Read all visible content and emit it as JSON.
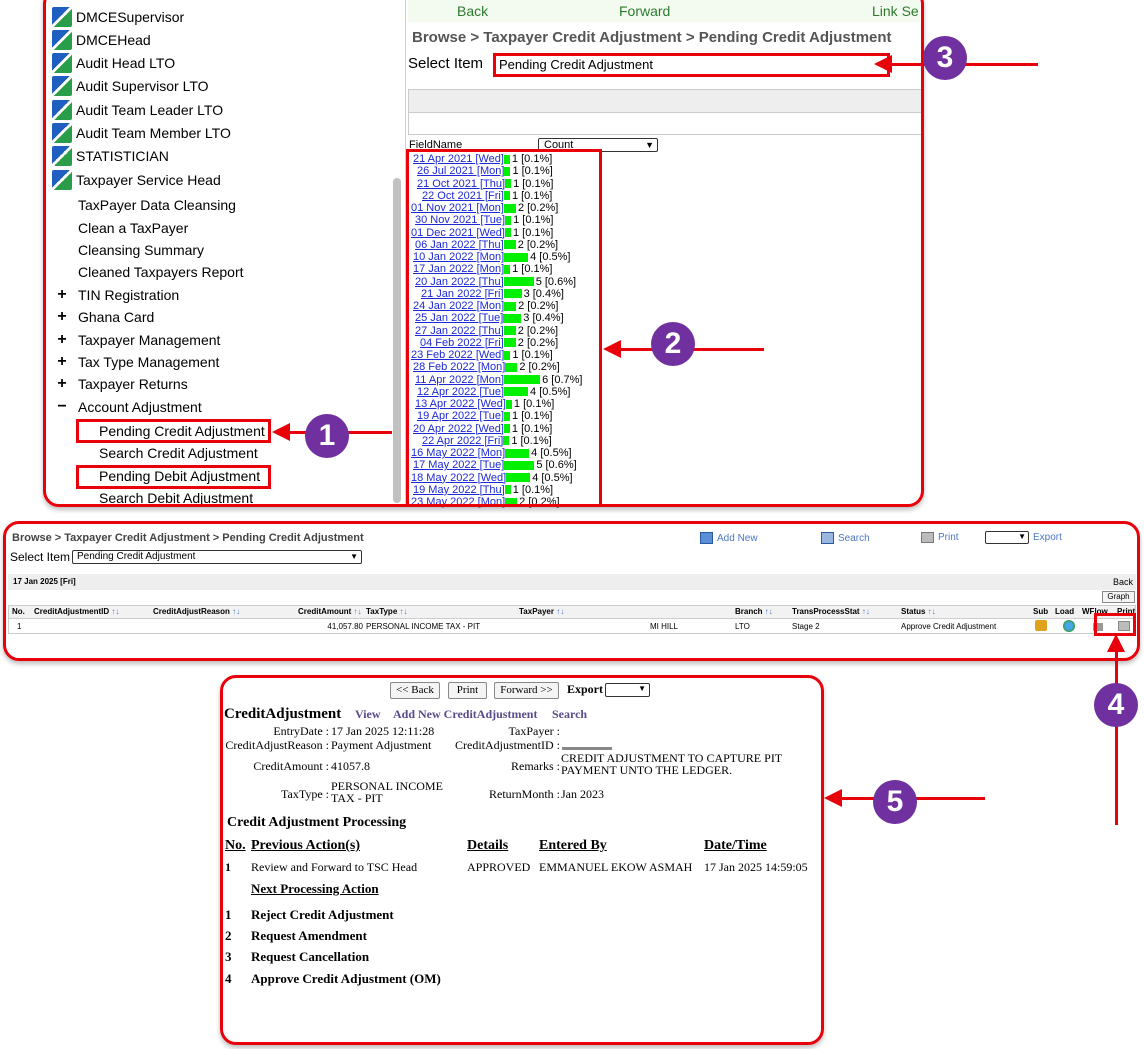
{
  "panel1": {
    "roles": [
      "DMCESupervisor",
      "DMCEHead",
      "Audit Head LTO",
      "Audit Supervisor LTO",
      "Audit Team Leader LTO",
      "Audit Team Member LTO",
      "STATISTICIAN",
      "Taxpayer Service Head"
    ],
    "submenu": [
      "TaxPayer Data Cleansing",
      "Clean a TaxPayer",
      "Cleansing Summary",
      "Cleaned Taxpayers Report"
    ],
    "expandable": [
      {
        "sign": "+",
        "label": "TIN Registration"
      },
      {
        "sign": "+",
        "label": "Ghana Card"
      },
      {
        "sign": "+",
        "label": "Taxpayer Management"
      },
      {
        "sign": "+",
        "label": "Tax Type Management"
      },
      {
        "sign": "+",
        "label": "Taxpayer Returns"
      },
      {
        "sign": "−",
        "label": "Account Adjustment"
      }
    ],
    "account_items": [
      "Pending Credit Adjustment",
      "Search Credit Adjustment",
      "Pending Debit Adjustment",
      "Search Debit Adjustment"
    ],
    "nav": {
      "back": "Back",
      "forward": "Forward",
      "link": "Link Se"
    },
    "breadcrumb": "Browse > Taxpayer Credit Adjustment > Pending Credit Adjustment",
    "select_label": "Select Item",
    "select_value": "Pending Credit Adjustment",
    "fieldname_label": "FieldName",
    "fieldname_value": "Count",
    "dates": [
      {
        "date": "21 Apr 2021 [Wed]",
        "count": 1,
        "text": "1 [0.1%]"
      },
      {
        "date": "26 Jul 2021 [Mon]",
        "count": 1,
        "text": "1 [0.1%]"
      },
      {
        "date": "21 Oct 2021 [Thu]",
        "count": 1,
        "text": "1 [0.1%]"
      },
      {
        "date": "22 Oct 2021 [Fri]",
        "count": 1,
        "text": "1 [0.1%]"
      },
      {
        "date": "01 Nov 2021 [Mon]",
        "count": 2,
        "text": "2 [0.2%]"
      },
      {
        "date": "30 Nov 2021 [Tue]",
        "count": 1,
        "text": "1 [0.1%]"
      },
      {
        "date": "01 Dec 2021 [Wed]",
        "count": 1,
        "text": "1 [0.1%]"
      },
      {
        "date": "06 Jan 2022 [Thu]",
        "count": 2,
        "text": "2 [0.2%]"
      },
      {
        "date": "10 Jan 2022 [Mon]",
        "count": 4,
        "text": "4 [0.5%]"
      },
      {
        "date": "17 Jan 2022 [Mon]",
        "count": 1,
        "text": "1 [0.1%]"
      },
      {
        "date": "20 Jan 2022 [Thu]",
        "count": 5,
        "text": "5 [0.6%]"
      },
      {
        "date": "21 Jan 2022 [Fri]",
        "count": 3,
        "text": "3 [0.4%]"
      },
      {
        "date": "24 Jan 2022 [Mon]",
        "count": 2,
        "text": "2 [0.2%]"
      },
      {
        "date": "25 Jan 2022 [Tue]",
        "count": 3,
        "text": "3 [0.4%]"
      },
      {
        "date": "27 Jan 2022 [Thu]",
        "count": 2,
        "text": "2 [0.2%]"
      },
      {
        "date": "04 Feb 2022 [Fri]",
        "count": 2,
        "text": "2 [0.2%]"
      },
      {
        "date": "23 Feb 2022 [Wed]",
        "count": 1,
        "text": "1 [0.1%]"
      },
      {
        "date": "28 Feb 2022 [Mon]",
        "count": 2,
        "text": "2 [0.2%]"
      },
      {
        "date": "11 Apr 2022 [Mon]",
        "count": 6,
        "text": "6 [0.7%]"
      },
      {
        "date": "12 Apr 2022 [Tue]",
        "count": 4,
        "text": "4 [0.5%]"
      },
      {
        "date": "13 Apr 2022 [Wed]",
        "count": 1,
        "text": "1 [0.1%]"
      },
      {
        "date": "19 Apr 2022 [Tue]",
        "count": 1,
        "text": "1 [0.1%]"
      },
      {
        "date": "20 Apr 2022 [Wed]",
        "count": 1,
        "text": "1 [0.1%]"
      },
      {
        "date": "22 Apr 2022 [Fri]",
        "count": 1,
        "text": "1 [0.1%]"
      },
      {
        "date": "16 May 2022 [Mon]",
        "count": 4,
        "text": "4 [0.5%]"
      },
      {
        "date": "17 May 2022 [Tue]",
        "count": 5,
        "text": "5 [0.6%]"
      },
      {
        "date": "18 May 2022 [Wed]",
        "count": 4,
        "text": "4 [0.5%]"
      },
      {
        "date": "19 May 2022 [Thu]",
        "count": 1,
        "text": "1 [0.1%]"
      },
      {
        "date": "23 May 2022 [Mon]",
        "count": 2,
        "text": "2 [0.2%]"
      }
    ]
  },
  "panel2": {
    "breadcrumb": "Browse > Taxpayer Credit Adjustment > Pending Credit Adjustment",
    "select_label": "Select Item",
    "select_value": "Pending Credit Adjustment",
    "toolbar": {
      "add_new": "Add New",
      "search": "Search",
      "print": "Print",
      "export": "Export"
    },
    "date_heading": "17 Jan 2025 [Fri]",
    "back": "Back",
    "graph": "Graph",
    "columns": [
      "No.",
      "CreditAdjustmentID",
      "CreditAdjustReason",
      "CreditAmount",
      "TaxType",
      "TaxPayer",
      "Branch",
      "TransProcessStat",
      "Status",
      "Sub",
      "Load",
      "WFlow",
      "Print"
    ],
    "row": {
      "no": "1",
      "amount": "41,057.80",
      "taxtype": "PERSONAL INCOME TAX - PIT",
      "taxpayer": "MI HILL",
      "branch": "LTO",
      "stat": "Stage 2",
      "status": "Approve Credit Adjustment"
    }
  },
  "panel3": {
    "buttons": {
      "back": "<< Back",
      "print": "Print",
      "forward": "Forward >>",
      "export": "Export"
    },
    "title": "CreditAdjustment",
    "links": {
      "view": "View",
      "add_new": "Add New CreditAdjustment",
      "search": "Search"
    },
    "fields": {
      "entry_date_label": "EntryDate :",
      "entry_date": "17 Jan 2025 12:11:28",
      "taxpayer_label": "TaxPayer :",
      "reason_label": "CreditAdjustReason :",
      "reason": "Payment Adjustment",
      "id_label": "CreditAdjustmentID :",
      "amount_label": "CreditAmount :",
      "amount": "41057.8",
      "remarks_label": "Remarks :",
      "remarks": "CREDIT ADJUSTMENT TO CAPTURE PIT PAYMENT UNTO THE LEDGER.",
      "taxtype_label": "TaxType :",
      "taxtype": "PERSONAL INCOME TAX - PIT",
      "return_month_label": "ReturnMonth :",
      "return_month": "Jan 2023"
    },
    "processing_title": "Credit Adjustment Processing",
    "headers": {
      "no": "No.",
      "prev": "Previous Action(s)",
      "details": "Details",
      "entered_by": "Entered By",
      "datetime": "Date/Time"
    },
    "prev_row": {
      "no": "1",
      "action": "Review and Forward to TSC Head",
      "details": "APPROVED",
      "entered_by": "EMMANUEL EKOW ASMAH",
      "datetime": "17 Jan 2025 14:59:05"
    },
    "next_title": "Next Processing Action",
    "next_actions": [
      {
        "no": "1",
        "label": "Reject Credit Adjustment"
      },
      {
        "no": "2",
        "label": "Request Amendment"
      },
      {
        "no": "3",
        "label": "Request Cancellation"
      },
      {
        "no": "4",
        "label": "Approve Credit Adjustment (OM)"
      }
    ]
  },
  "callouts": [
    "1",
    "2",
    "3",
    "4",
    "5"
  ],
  "colors": {
    "accent_red": "#e8000b",
    "badge_purple": "#7030a0",
    "bar_green": "#00f000",
    "link_blue": "#1d29d6"
  }
}
